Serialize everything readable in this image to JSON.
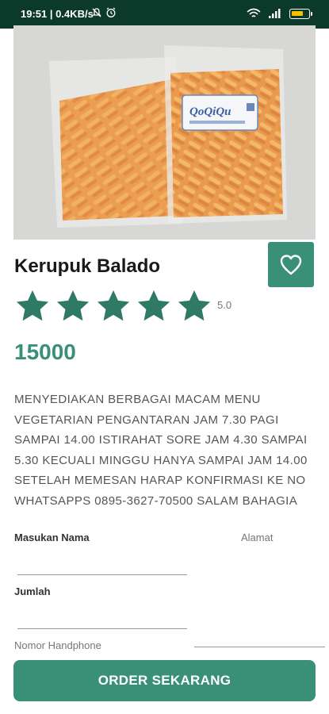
{
  "status_bar": {
    "time": "19:51 | 0.4KB/s",
    "battery_color": "#f2c200"
  },
  "product": {
    "title": "Kerupuk Balado",
    "rating": 5.0,
    "rating_label": "5.0",
    "stars_total": 5,
    "stars_filled": 5,
    "price": "15000",
    "description": "MENYEDIAKAN BERBAGAI MACAM MENU VEGETARIAN  PENGANTARAN JAM 7.30 PAGI SAMPAI 14.00 ISTIRAHAT SORE JAM 4.30 SAMPAI 5.30  KECUALI MINGGU HANYA SAMPAI JAM 14.00  SETELAH MEMESAN HARAP KONFIRMASI KE NO WHATSAPPS 0895-3627-70500  SALAM BAHAGIA",
    "package_label": "QoQiQu"
  },
  "form": {
    "name_label": "Masukan Nama",
    "address_label": "Alamat",
    "quantity_label": "Jumlah",
    "phone_label": "Nomor Handphone"
  },
  "actions": {
    "order_label": "ORDER SEKARANG",
    "favorite_icon": "heart-outline-icon"
  },
  "colors": {
    "accent": "#3a8f77",
    "status_bar": "#0c3a2a"
  }
}
